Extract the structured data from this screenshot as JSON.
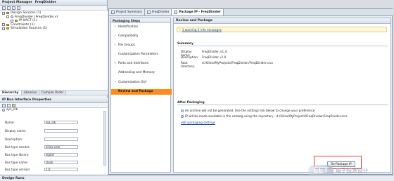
{
  "app": {
    "panel_title": "Project Manager",
    "project_name": "FreqDivider",
    "status_bar": "Design Runs"
  },
  "project_manager": {
    "tree": [
      "Design Sources (1)",
      "FreqDivider (FreqDivider.v)",
      "IP-XACT (1)",
      "Constraints (1)",
      "Simulation Sources (1)"
    ],
    "tabs": [
      "Hierarchy",
      "Libraries",
      "Compile Order"
    ]
  },
  "ip_bus_interface_properties": {
    "title": "IP Bus Interface Properties",
    "interface_name": "sys_clk",
    "labels": [
      "Name:",
      "Display name:",
      "Description:",
      "Bus type vendor:",
      "Bus type library:",
      "Bus type name:",
      "Bus type version:"
    ],
    "values": [
      "sys_clk",
      "",
      "",
      "xilinx.com",
      "signal",
      "clock",
      "1.0"
    ]
  },
  "document_tabs": [
    {
      "label": "Project Summary"
    },
    {
      "label": "FreqDivider"
    },
    {
      "label": "Package IP - FreqDivider"
    }
  ],
  "packaging_steps": {
    "header": "Packaging Steps",
    "items": [
      {
        "label": "Identification",
        "checked": true
      },
      {
        "label": "Compatibility",
        "checked": true
      },
      {
        "label": "File Groups",
        "checked": true
      },
      {
        "label": "Customization Parameters",
        "checked": false
      },
      {
        "label": "Ports and Interfaces",
        "checked": false
      },
      {
        "label": "Addressing and Memory",
        "checked": false
      },
      {
        "label": "Customization GUI",
        "checked": true
      },
      {
        "label": "Review and Package",
        "checked": false,
        "selected": true
      }
    ]
  },
  "review": {
    "title": "Review and Package",
    "messages": "1 warning 2 info messages",
    "summary_title": "Summary",
    "summary_rows": [
      {
        "k": "Display name:",
        "v": "FreqDivider_v1_0"
      },
      {
        "k": "Description:",
        "v": "FreqDivider v1.0"
      },
      {
        "k": "Root directory:",
        "v": "d:/Xilinx/MyProjects/FreqDivider/FreqDivider.srcs"
      }
    ],
    "after_title": "After Packaging",
    "after_rows": [
      "An archive will not be generated. Use the settings link below to change your preference",
      "IP will be made available in the catalog using the repository - d:/Xilinx/MyProjects/FreqDivider/FreqDivider.srcs"
    ],
    "edit_link": "edit packaging settings",
    "repackage_button": "Re-Package IP"
  },
  "watermark": {
    "logo": "EET",
    "text": "电子技术设计"
  }
}
